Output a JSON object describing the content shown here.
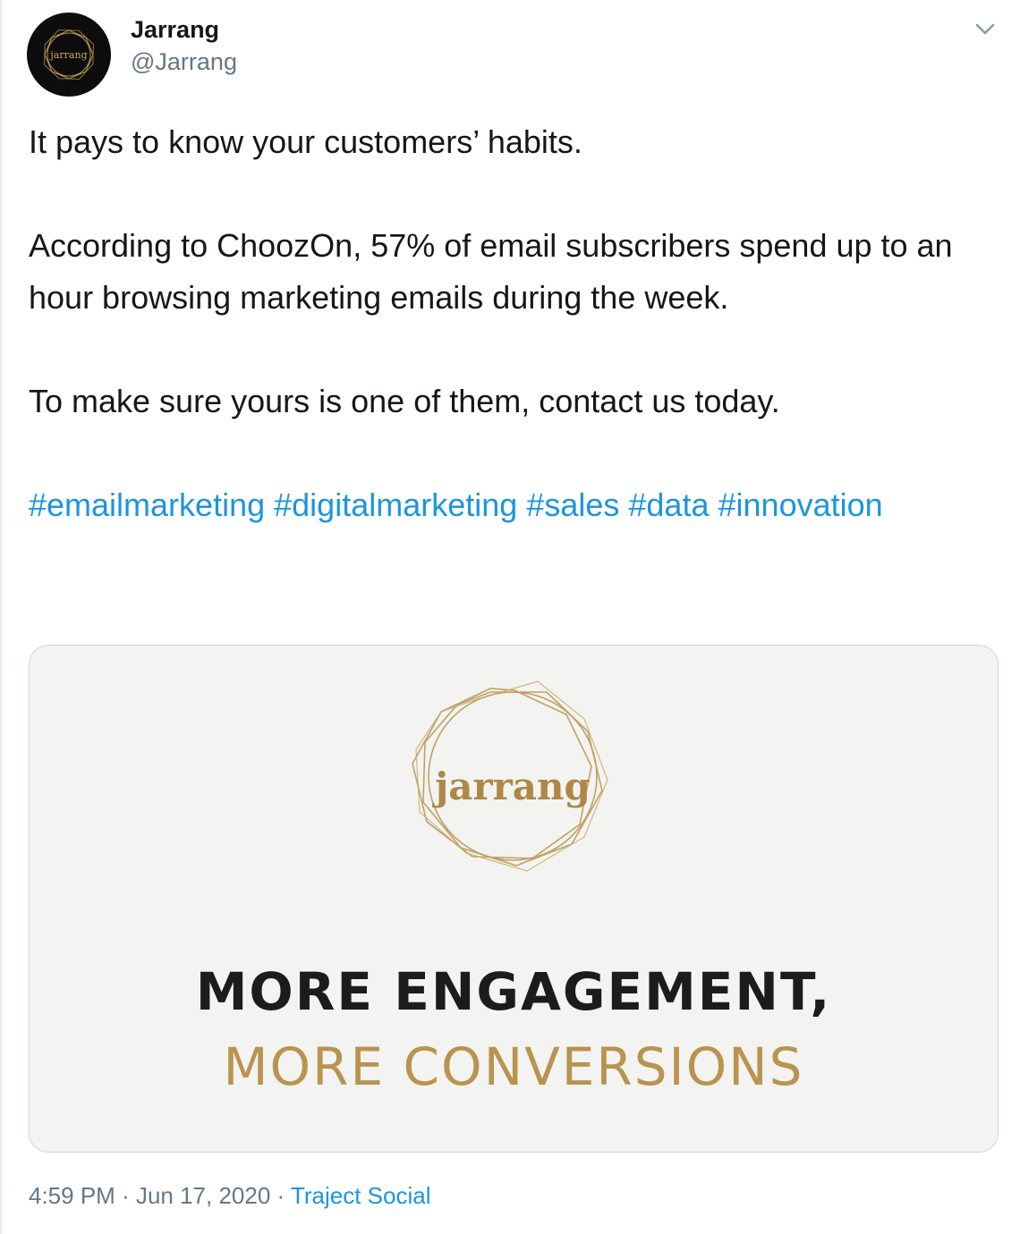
{
  "author": {
    "name": "Jarrang",
    "handle": "@Jarrang",
    "avatar_text": "jarrang"
  },
  "menu": {
    "icon": "chevron-down-icon"
  },
  "tweet": {
    "lines": [
      "It pays to know your customers’ habits.",
      "According to ChoozOn, 57% of email subscribers spend up to an hour browsing marketing emails during the week.",
      "To make sure yours is one of them, contact us today."
    ],
    "hashtags": [
      "#emailmarketing",
      "#digitalmarketing",
      "#sales",
      "#data",
      "#innovation"
    ]
  },
  "media": {
    "logo_text": "jarrang",
    "headline_line1": "MORE ENGAGEMENT,",
    "headline_line2": "MORE CONVERSIONS",
    "colors": {
      "gold": "#b8944f",
      "dark": "#1c1c1c",
      "background": "#f3f3f1"
    }
  },
  "meta": {
    "time": "4:59 PM",
    "separator": " · ",
    "date": "Jun 17, 2020",
    "source": "Traject Social"
  },
  "colors": {
    "link": "#1b95e0",
    "text": "#14171a",
    "muted": "#657786"
  }
}
